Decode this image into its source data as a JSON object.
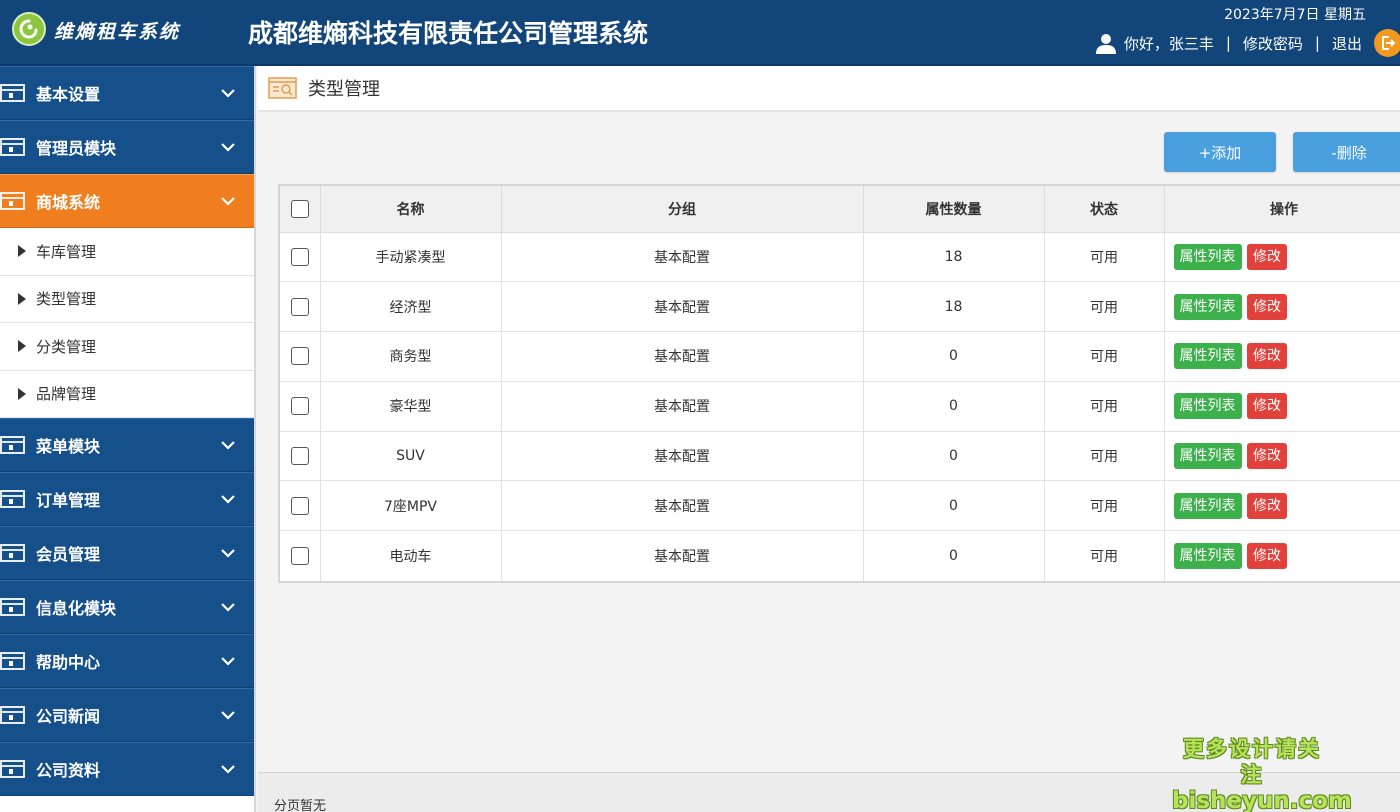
{
  "header": {
    "logo_text": "维熵租车系统",
    "system_title": "成都维熵科技有限责任公司管理系统",
    "date": "2023年7月7日 星期五",
    "greeting": "你好，张三丰",
    "separator": "|",
    "change_password": "修改密码",
    "logout": "退出"
  },
  "sidebar": {
    "groups_top": [
      {
        "label": "基本设置"
      },
      {
        "label": "管理员模块"
      }
    ],
    "active_group": {
      "label": "商城系统"
    },
    "sub_items": [
      {
        "label": "车库管理"
      },
      {
        "label": "类型管理"
      },
      {
        "label": "分类管理"
      },
      {
        "label": "品牌管理"
      }
    ],
    "groups_bottom": [
      {
        "label": "菜单模块"
      },
      {
        "label": "订单管理"
      },
      {
        "label": "会员管理"
      },
      {
        "label": "信息化模块"
      },
      {
        "label": "帮助中心"
      },
      {
        "label": "公司新闻"
      },
      {
        "label": "公司资料"
      }
    ]
  },
  "page": {
    "title": "类型管理",
    "add_button": "+添加",
    "delete_button": "-删除"
  },
  "table": {
    "columns": [
      "名称",
      "分组",
      "属性数量",
      "状态",
      "操作"
    ],
    "action_attr": "属性列表",
    "action_edit": "修改",
    "rows": [
      {
        "name": "手动紧凑型",
        "group": "基本配置",
        "count": "18",
        "status": "可用"
      },
      {
        "name": "经济型",
        "group": "基本配置",
        "count": "18",
        "status": "可用"
      },
      {
        "name": "商务型",
        "group": "基本配置",
        "count": "0",
        "status": "可用"
      },
      {
        "name": "豪华型",
        "group": "基本配置",
        "count": "0",
        "status": "可用"
      },
      {
        "name": "SUV",
        "group": "基本配置",
        "count": "0",
        "status": "可用"
      },
      {
        "name": "7座MPV",
        "group": "基本配置",
        "count": "0",
        "status": "可用"
      },
      {
        "name": "电动车",
        "group": "基本配置",
        "count": "0",
        "status": "可用"
      }
    ]
  },
  "footer": {
    "pagination_text": "分页暂无"
  },
  "watermark": {
    "line1": "更多设计请关注",
    "line2": "bisheyun.com"
  },
  "colors": {
    "header_bg": "#12457a",
    "menu_bg": "#16508a",
    "menu_active": "#f07e1e",
    "button_blue": "#4a9fde",
    "tag_green": "#3cb04a",
    "tag_red": "#e2403b"
  }
}
